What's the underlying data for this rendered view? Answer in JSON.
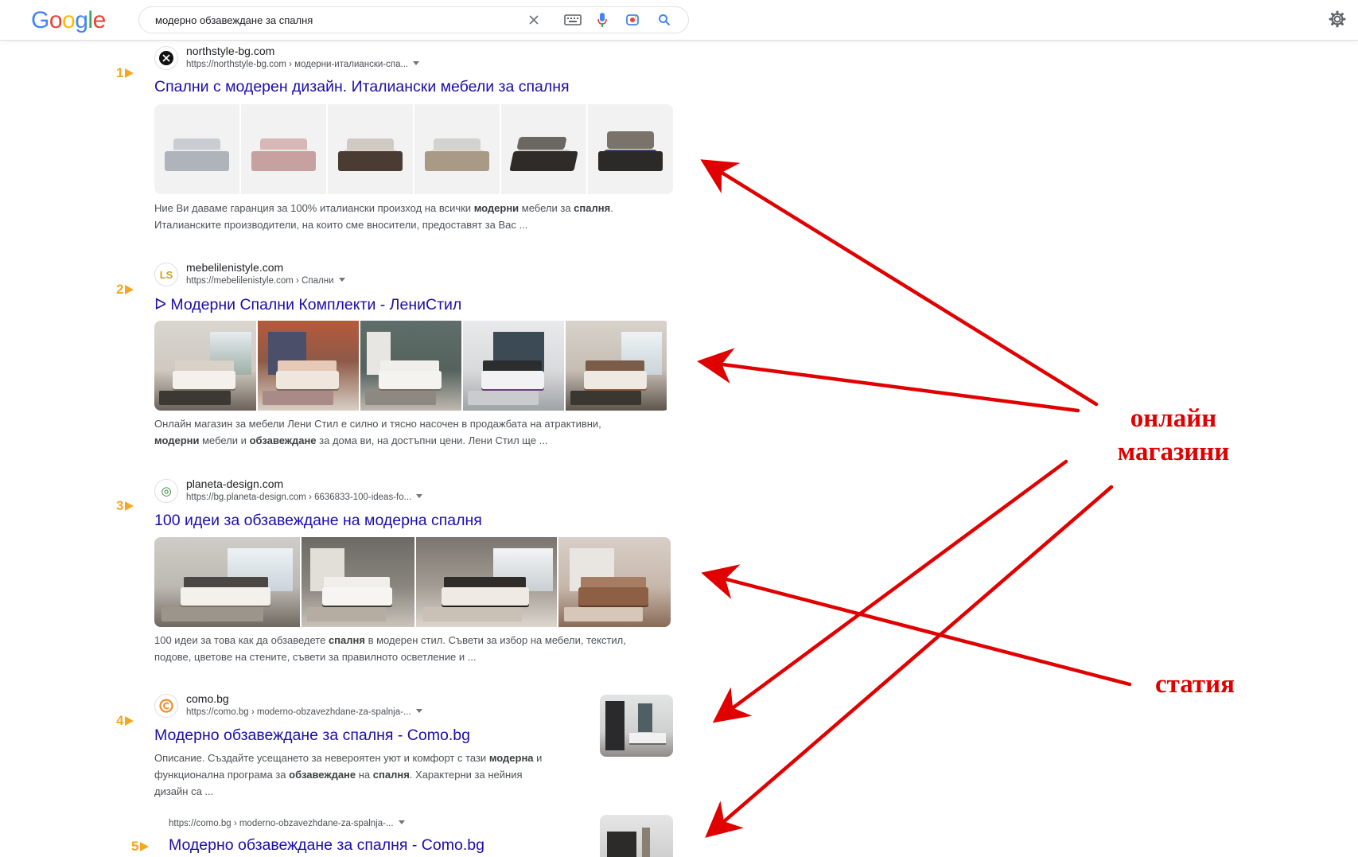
{
  "header": {
    "logo": "Google",
    "search_query": "модерно обзавеждане за спалня",
    "colors": {
      "blue": "#4285F4",
      "red": "#EA4335",
      "yellow": "#FBBC05",
      "green": "#34A853"
    }
  },
  "results": [
    {
      "rank": "1",
      "site": "northstyle-bg.com",
      "url": "https://northstyle-bg.com › модерни-италиански-спа...",
      "title": "Спални с модерен дизайн. Италиански мебели за спалня",
      "snippet_line1": [
        "Ние Ви даваме гаранция за 100% италиански произход на всички ",
        "модерни",
        " мебели за ",
        "спалня",
        "."
      ],
      "snippet_line2": "Италианските производители, на които сме вносители, предоставят за Вас ...",
      "favicon": "×"
    },
    {
      "rank": "2",
      "site": "mebelilenistyle.com",
      "url": "https://mebelilenistyle.com › Спални",
      "title": "ᐅ Модерни Спални Комплекти - ЛениСтил",
      "snippet_line1": "Онлайн магазин за мебели Лени Стил е силно и тясно насочен в продажбата на атрактивни,",
      "snippet_line2": [
        "модерни",
        " мебели и ",
        "обзавеждане",
        " за дома ви, на достъпни цени. Лени Стил ще ..."
      ],
      "favicon": "LS"
    },
    {
      "rank": "3",
      "site": "planeta-design.com",
      "url": "https://bg.planeta-design.com › 6636833-100-ideas-fo...",
      "title": "100 идеи за обзавеждане на модерна спалня",
      "snippet_line1": [
        "100 идеи за това как да обзаведете ",
        "спалня",
        " в модерен стил. Съвети за избор на мебели, текстил,"
      ],
      "snippet_line2": "подове, цветове на стените, съвети за правилното осветление и ...",
      "favicon": "◎"
    },
    {
      "rank": "4",
      "site": "como.bg",
      "url": "https://como.bg › moderno-obzavezhdane-za-spalnja-...",
      "title": "Модерно обзавеждане за спалня - Como.bg",
      "snippet_line1": [
        "Описание. Създайте усещането за невероятен уют и комфорт с тази ",
        "модерна",
        " и"
      ],
      "snippet_line2": [
        "функционална програма за ",
        "обзавеждане",
        " на ",
        "спалня",
        ". Характерни за нейния"
      ],
      "snippet_line3": "дизайн са ...",
      "favicon": "C"
    },
    {
      "rank": "5",
      "url": "https://como.bg › moderno-obzavezhdane-za-spalnja-...",
      "title": "Модерно обзавеждане за спалня - Como.bg"
    }
  ],
  "annotations": {
    "online_stores_line1": "онлайн",
    "online_stores_line2": "магазини",
    "article": "статия",
    "arrow_color": "#e00000"
  }
}
